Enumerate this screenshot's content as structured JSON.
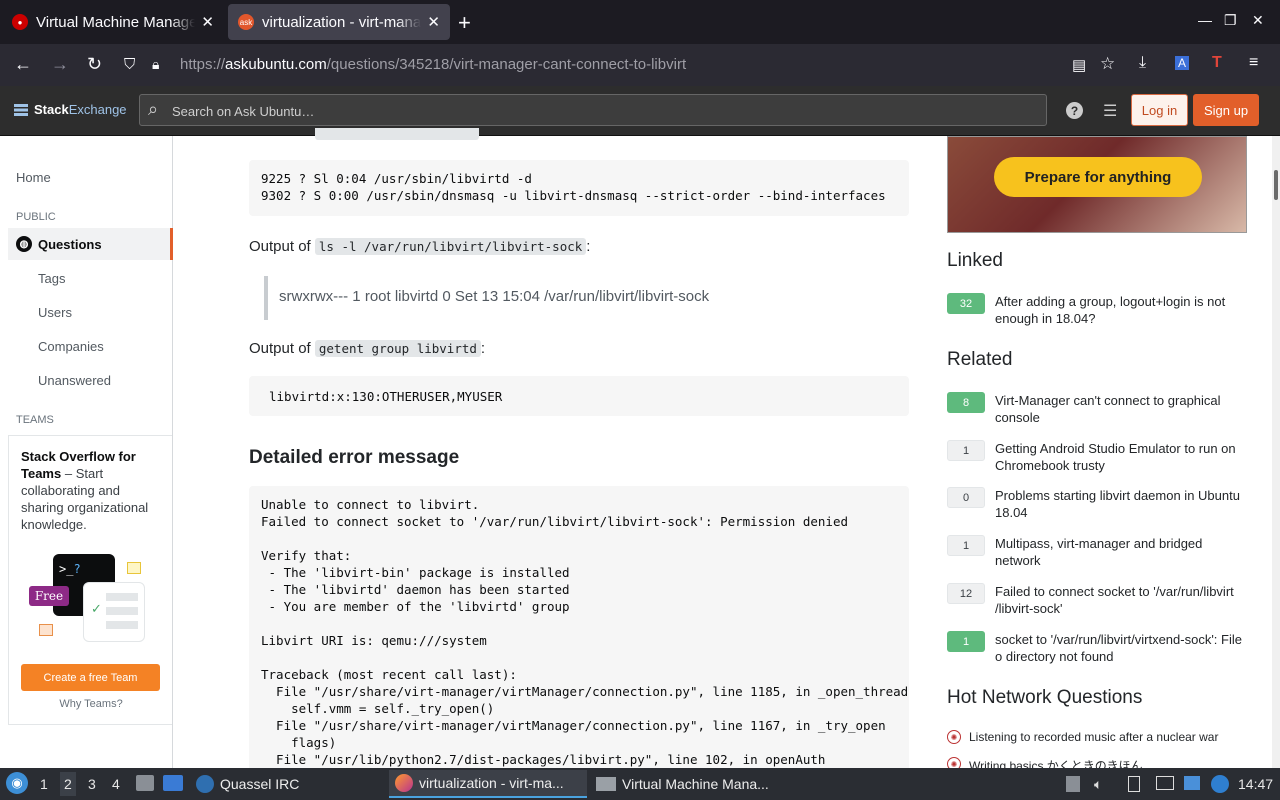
{
  "browser": {
    "tabs": [
      {
        "title": "Virtual Machine Manager",
        "state": "inactive",
        "favicon": "redhat-icon"
      },
      {
        "title": "virtualization - virt-manag",
        "state": "active",
        "favicon": "askubuntu-icon"
      }
    ],
    "url_prefix": "https://",
    "url_host": "askubuntu.com",
    "url_path": "/questions/345218/virt-manager-cant-connect-to-libvirt"
  },
  "header": {
    "logo_a": "Stack",
    "logo_b": "Exchange",
    "search_placeholder": "Search on Ask Ubuntu…",
    "login": "Log in",
    "signup": "Sign up"
  },
  "leftnav": {
    "home": "Home",
    "public": "PUBLIC",
    "questions": "Questions",
    "tags": "Tags",
    "users": "Users",
    "companies": "Companies",
    "unanswered": "Unanswered",
    "teams": "TEAMS",
    "teams_title": "Stack Overflow for Teams",
    "teams_text": " – Start collaborating and sharing organizational knowledge.",
    "free_badge": "Free",
    "create_team": "Create a free Team",
    "why_teams": "Why Teams?"
  },
  "main": {
    "code1": "9225 ? Sl 0:04 /usr/sbin/libvirtd -d\n9302 ? S 0:00 /usr/sbin/dnsmasq -u libvirt-dnsmasq --strict-order --bind-interfaces",
    "output_of_1": "Output of ",
    "cmd1": "ls -l /var/run/libvirt/libvirt-sock",
    "colon": ":",
    "quote1": "srwxrwx--- 1 root libvirtd 0 Set 13 15:04 /var/run/libvirt/libvirt-sock",
    "output_of_2": "Output of ",
    "cmd2": "getent group libvirtd",
    "code2": "libvirtd:x:130:OTHERUSER,MYUSER",
    "heading": "Detailed error message",
    "code3": "Unable to connect to libvirt.\nFailed to connect socket to '/var/run/libvirt/libvirt-sock': Permission denied\n\nVerify that:\n - The 'libvirt-bin' package is installed\n - The 'libvirtd' daemon has been started\n - You are member of the 'libvirtd' group\n\nLibvirt URI is: qemu:///system\n\nTraceback (most recent call last):\n  File \"/usr/share/virt-manager/virtManager/connection.py\", line 1185, in _open_thread\n    self.vmm = self._try_open()\n  File \"/usr/share/virt-manager/virtManager/connection.py\", line 1167, in _try_open\n    flags)\n  File \"/usr/lib/python2.7/dist-packages/libvirt.py\", line 102, in openAuth"
  },
  "sidebar": {
    "ad_cta": "Prepare for anything",
    "linked_title": "Linked",
    "linked": [
      {
        "score": "32",
        "accepted": true,
        "title": "After adding a group, logout+login is not enough in 18.04?"
      }
    ],
    "related_title": "Related",
    "related": [
      {
        "score": "8",
        "accepted": true,
        "title": "Virt-Manager can't connect to graphical console"
      },
      {
        "score": "1",
        "accepted": false,
        "title": "Getting Android Studio Emulator to run on Chromebook trusty"
      },
      {
        "score": "0",
        "accepted": false,
        "title": "Problems starting libvirt daemon in Ubuntu 18.04"
      },
      {
        "score": "1",
        "accepted": false,
        "title": "Multipass, virt-manager and bridged network"
      },
      {
        "score": "12",
        "accepted": false,
        "title": "Failed to connect socket to '/var/run/libvirt /libvirt-sock'"
      },
      {
        "score": "1",
        "accepted": true,
        "title": "socket to '/var/run/libvirt/virtxend-sock': File o directory not found"
      }
    ],
    "hnq_title": "Hot Network Questions",
    "hnq": [
      "Listening to recorded music after a nuclear war",
      "Writing basics かくときのきほん"
    ]
  },
  "taskbar": {
    "workspaces": [
      "1",
      "2",
      "3",
      "4"
    ],
    "current_workspace": "2",
    "tasks": [
      {
        "label": "Quassel IRC"
      },
      {
        "label": "virtualization - virt-ma..."
      },
      {
        "label": "Virtual Machine Mana..."
      }
    ],
    "clock": "14:47"
  }
}
